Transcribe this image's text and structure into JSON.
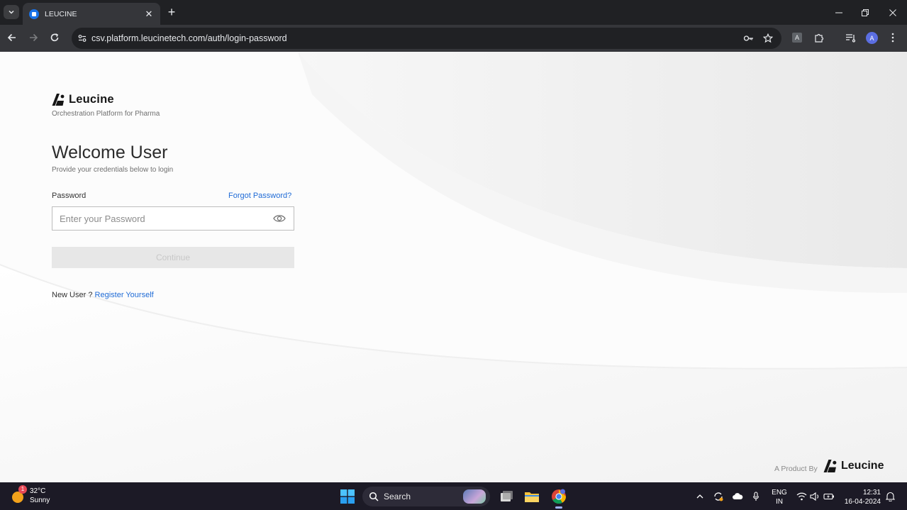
{
  "browser": {
    "tab_title": "LEUCINE",
    "url": "csv.platform.leucinetech.com/auth/login-password",
    "profile_initial": "A",
    "extension_letter": "A"
  },
  "page": {
    "brand_name": "Leucine",
    "tagline": "Orchestration Platform for Pharma",
    "welcome_title": "Welcome User",
    "welcome_subtitle": "Provide your credentials below to login",
    "password_label": "Password",
    "forgot_password": "Forgot Password?",
    "password_placeholder": "Enter your Password",
    "password_value": "",
    "continue_label": "Continue",
    "new_user_text": "New User ?",
    "register_link": "Register Yourself",
    "footer_prefix": "A Product By",
    "footer_brand": "Leucine"
  },
  "taskbar": {
    "weather_temp": "32°C",
    "weather_desc": "Sunny",
    "weather_badge": "1",
    "search_label": "Search",
    "lang_top": "ENG",
    "lang_bottom": "IN",
    "time": "12:31",
    "date": "16-04-2024"
  },
  "colors": {
    "link": "#1f6bd6",
    "chrome_dark": "#202124",
    "chrome_toolbar": "#35363a",
    "taskbar": "#1c1a26"
  }
}
